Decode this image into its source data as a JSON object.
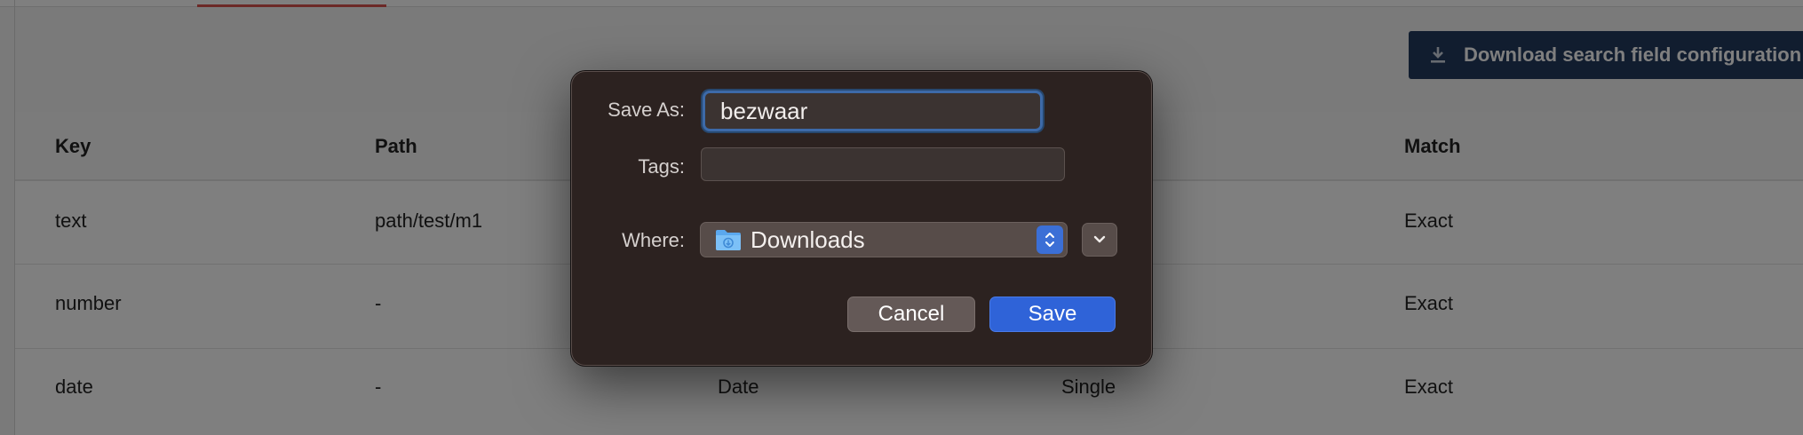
{
  "background": {
    "download_button": {
      "label": "Download search field configuration",
      "icon": "download-icon"
    },
    "table": {
      "headers": {
        "key": "Key",
        "path": "Path",
        "match": "Match"
      },
      "rows": [
        {
          "key": "text",
          "path": "path/test/m1",
          "type": "",
          "mode": "",
          "match": "Exact"
        },
        {
          "key": "number",
          "path": "-",
          "type": "",
          "mode": "",
          "match": "Exact"
        },
        {
          "key": "date",
          "path": "-",
          "type": "Date",
          "mode": "Single",
          "match": "Exact"
        }
      ]
    }
  },
  "dialog": {
    "save_as_label": "Save As:",
    "save_as_value": "bezwaar",
    "tags_label": "Tags:",
    "tags_value": "",
    "where_label": "Where:",
    "where_value": "Downloads",
    "folder_icon": "downloads-folder-icon",
    "cancel_label": "Cancel",
    "save_label": "Save",
    "accent_color": "#2f63d8"
  }
}
